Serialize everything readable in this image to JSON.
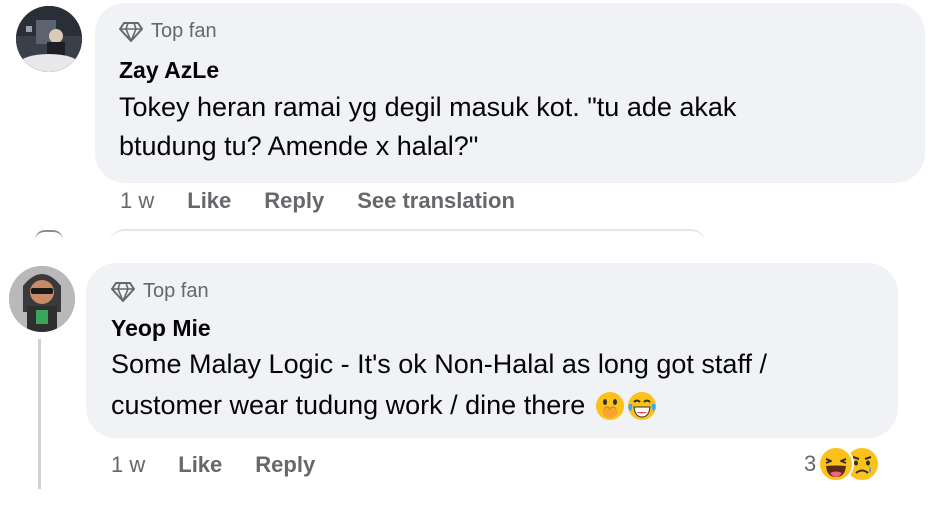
{
  "comments": [
    {
      "badge": "Top fan",
      "author": "Zay AzLe",
      "lines": [
        "Tokey heran ramai yg degil masuk kot. \"tu ade akak",
        "btudung tu? Amende x halal?\""
      ],
      "time": "1 w",
      "like": "Like",
      "reply": "Reply",
      "see_translation": "See translation"
    },
    {
      "badge": "Top fan",
      "author": "Yeop Mie",
      "lines": [
        "Some Malay Logic - It's ok Non-Halal as long got staff /",
        "customer wear tudung work / dine there"
      ],
      "emojis": [
        "face-with-hand-over-mouth-emoji",
        "face-with-tears-of-joy-emoji"
      ],
      "time": "1 w",
      "like": "Like",
      "reply": "Reply",
      "reaction_count": "3",
      "reaction_icons": [
        "haha-reaction-icon",
        "sad-reaction-icon"
      ]
    }
  ]
}
